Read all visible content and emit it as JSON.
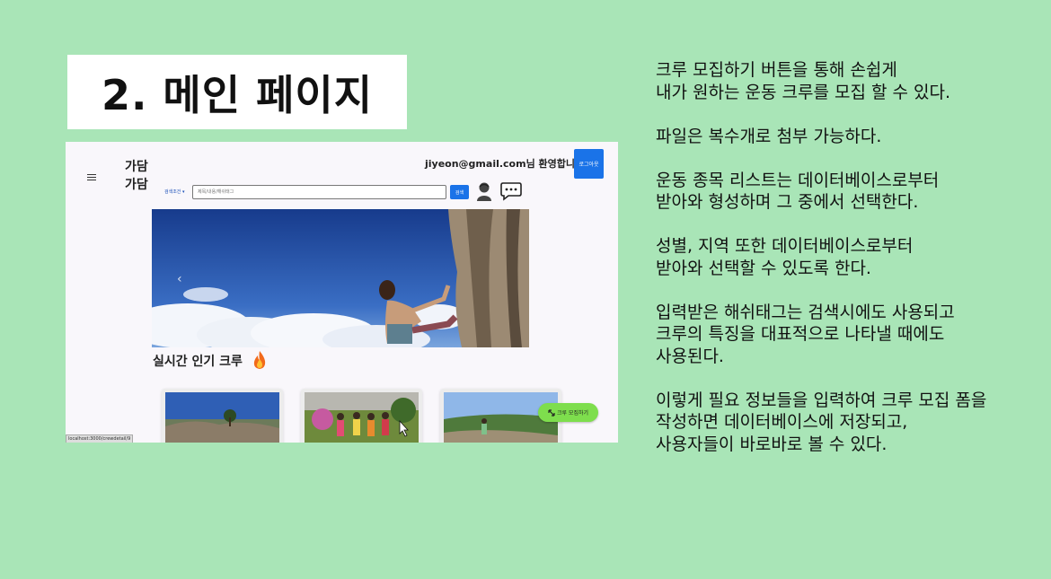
{
  "slide": {
    "title": "2. 메인 페이지",
    "paragraphs": [
      "크루 모집하기 버튼을 통해 손쉽게\n내가 원하는 운동 크루를 모집 할 수 있다.",
      "파일은 복수개로 첨부 가능하다.",
      "운동 종목 리스트는 데이터베이스로부터\n받아와 형성하며 그 중에서 선택한다.",
      "성별, 지역 또한 데이터베이스로부터\n받아와 선택할 수 있도록 한다.",
      "입력받은 해쉬태그는 검색시에도 사용되고\n크루의 특징을 대표적으로 나타낼 때에도\n사용된다.",
      "이렇게 필요 정보들을 입력하여 크루 모집 폼을\n작성하면 데이터베이스에 저장되고,\n사용자들이 바로바로 볼 수 있다."
    ]
  },
  "app": {
    "logo": "가담\n가담",
    "welcome": "jiyeon@gmail.com님 환영합니다!",
    "logout_label": "로그아웃",
    "search": {
      "dropdown_label": "검색조건 ▾",
      "placeholder": "제목/내용/해쉬태그",
      "button_label": "검색"
    },
    "section_title": "실시간 인기 크루",
    "recruit_button_label": "크루 모집하기",
    "status_url": "localhost:3000/crewdetail/9",
    "icons": {
      "menu": "hamburger-icon",
      "profile": "avatar-icon",
      "chat": "chat-icon",
      "fire": "fire-icon",
      "recruit": "expand-arrows-icon"
    },
    "colors": {
      "primary": "#1a73e8",
      "recruit": "#7ede4d",
      "slide_background": "#a9e5b7"
    }
  }
}
